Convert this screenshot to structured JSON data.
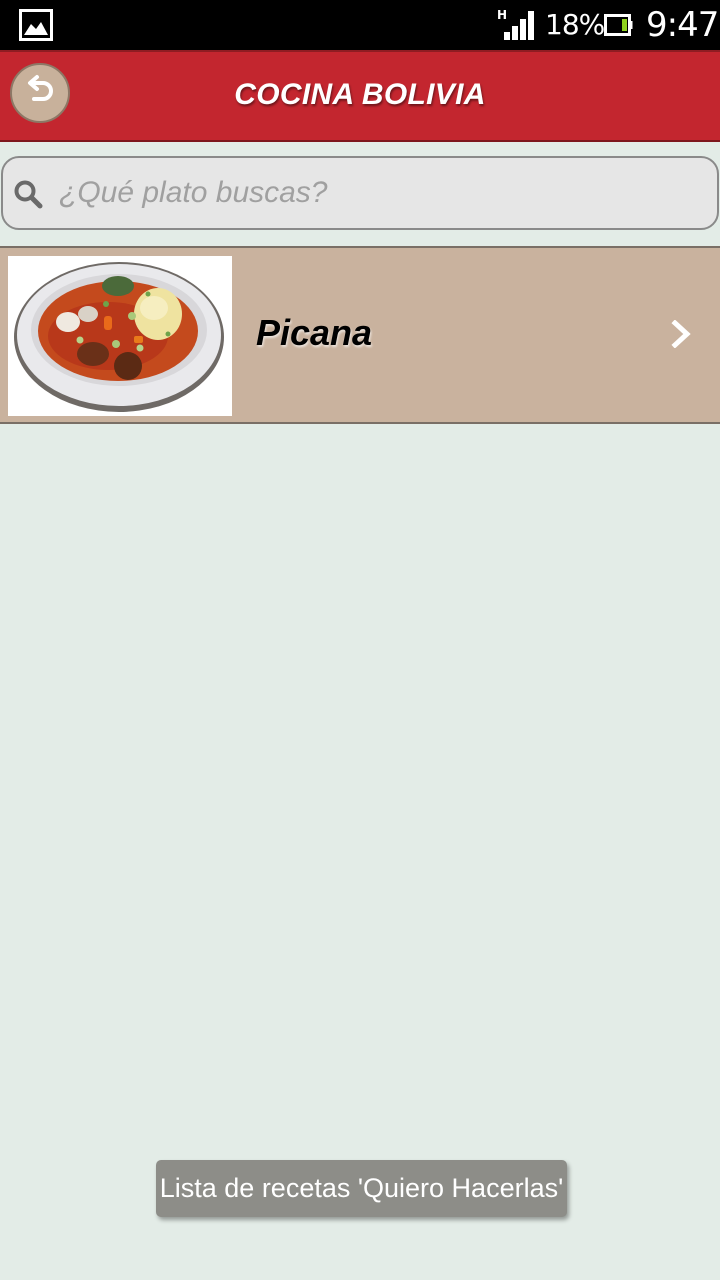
{
  "status_bar": {
    "network_type": "H",
    "battery_percent": "18%",
    "time": "9:47",
    "icons": [
      "gallery-icon",
      "signal-icon",
      "battery-icon"
    ]
  },
  "header": {
    "title": "COCINA BOLIVIA",
    "back_icon": "undo-arrow-icon",
    "accent_color": "#c3262f"
  },
  "search": {
    "placeholder": "¿Qué plato buscas?",
    "value": "",
    "icon": "search-icon"
  },
  "recipes": [
    {
      "name": "Picana",
      "image": "stew-plate-photo",
      "chevron": "chevron-right-icon"
    }
  ],
  "toast": {
    "message": "Lista de recetas 'Quiero Hacerlas'"
  },
  "colors": {
    "list_item_bg": "#c9b29e",
    "page_bg": "#e3ece7"
  }
}
